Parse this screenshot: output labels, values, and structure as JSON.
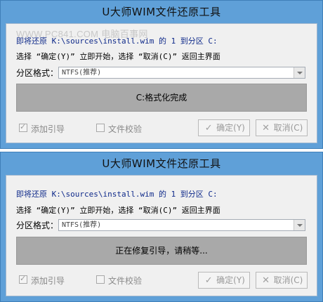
{
  "dialogs": [
    {
      "title": "U大师WIM文件还原工具",
      "watermark": "WWW.PC841.COM 电脑百事网",
      "info_line": "即将还原 K:\\sources\\install.wim 的 1 到分区 C:",
      "prompt_line": "选择 “确定(Y)” 立即开始，选择 “取消(C)” 返回主界面",
      "format_label": "分区格式：",
      "format_value": "NTFS(推荐)",
      "status": "C:格式化完成",
      "check_boot": "添加引导",
      "check_verify": "文件校验",
      "ok_label": "确定(Y)",
      "cancel_label": "取消(C)"
    },
    {
      "title": "U大师WIM文件还原工具",
      "info_line": "即将还原 K:\\sources\\install.wim 的 1 到分区 C:",
      "prompt_line": "选择 “确定(Y)” 立即开始，选择 “取消(C)” 返回主界面",
      "format_label": "分区格式：",
      "format_value": "NTFS(推荐)",
      "status": "正在修复引导，请稍等...",
      "check_boot": "添加引导",
      "check_verify": "文件校验",
      "ok_label": "确定(Y)",
      "cancel_label": "取消(C)"
    }
  ],
  "icons": {
    "ok": "check-icon",
    "cancel": "x-icon"
  }
}
